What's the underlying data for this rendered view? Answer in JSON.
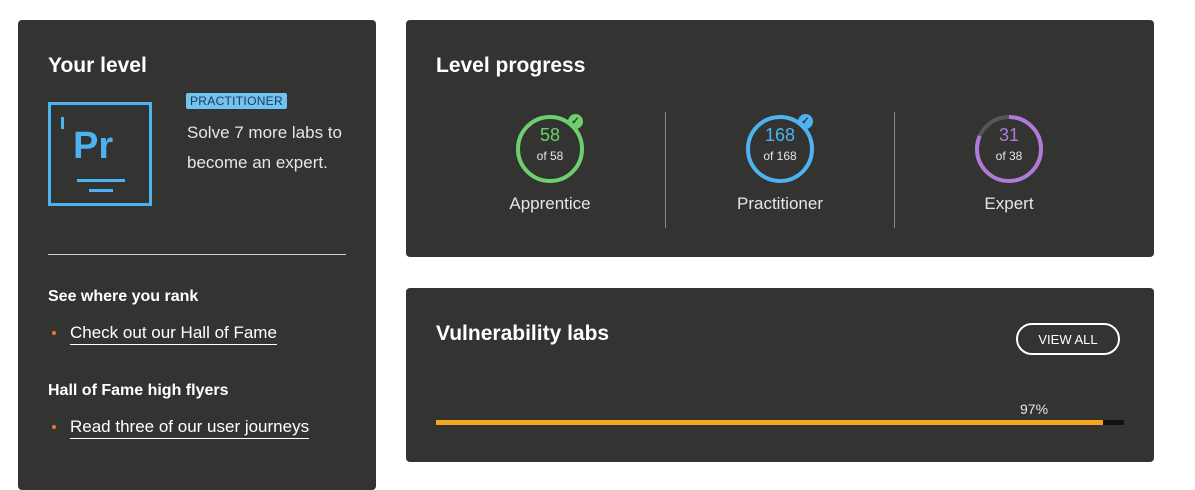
{
  "your_level": {
    "title": "Your level",
    "icon_abbr": "Pr",
    "badge": "PRACTITIONER",
    "message": "Solve 7 more labs to become an expert.",
    "rank_title": "See where you rank",
    "rank_link": "Check out our Hall of Fame",
    "flyers_title": "Hall of Fame high flyers",
    "flyers_link": "Read three of our user journeys"
  },
  "level_progress": {
    "title": "Level progress",
    "levels": [
      {
        "name": "Apprentice",
        "solved": "58",
        "of_text": "of 58",
        "fraction": 1.0,
        "color": "#6dcf6d",
        "completed": true,
        "icon": "check-icon"
      },
      {
        "name": "Practitioner",
        "solved": "168",
        "of_text": "of 168",
        "fraction": 1.0,
        "color": "#4cb3f0",
        "completed": true,
        "icon": "check-icon"
      },
      {
        "name": "Expert",
        "solved": "31",
        "of_text": "of 38",
        "fraction": 0.8158,
        "color": "#b07ad8",
        "completed": false
      }
    ]
  },
  "vulnerability_labs": {
    "title": "Vulnerability labs",
    "view_all_label": "VIEW ALL",
    "percent_label": "97%",
    "percent": 0.97,
    "bar_color": "#f5a623"
  }
}
